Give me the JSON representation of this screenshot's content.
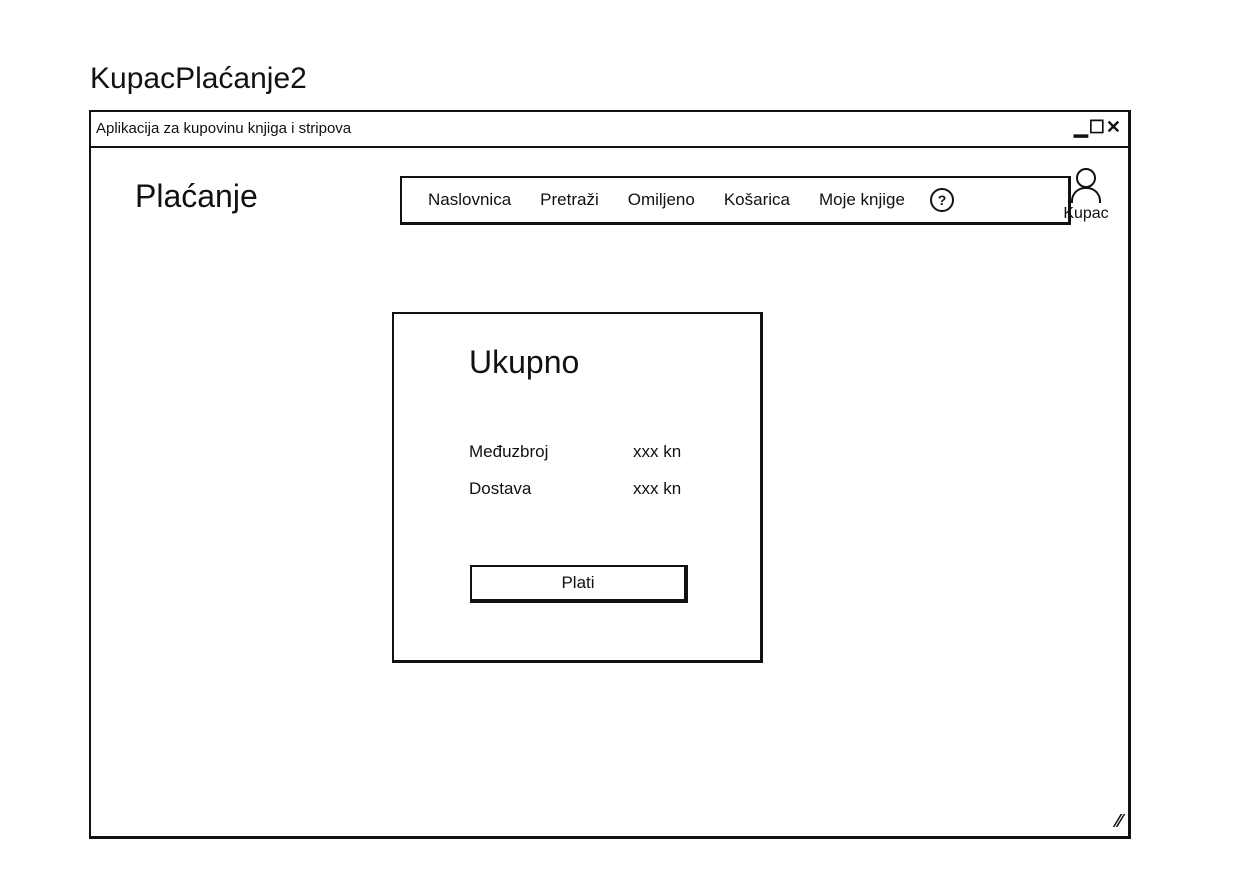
{
  "page_title": "KupacPlaćanje2",
  "window": {
    "title": "Aplikacija za kupovinu knjiga i stripova",
    "controls": "▁☐✕",
    "resize_icon": "⁄⁄"
  },
  "header": {
    "heading": "Plaćanje",
    "nav": [
      {
        "label": "Naslovnica"
      },
      {
        "label": "Pretraži"
      },
      {
        "label": "Omiljeno"
      },
      {
        "label": "Košarica"
      },
      {
        "label": "Moje knjige"
      }
    ],
    "help": "?",
    "user_label": "Kupac"
  },
  "summary": {
    "title": "Ukupno",
    "rows": [
      {
        "label": "Međuzbroj",
        "value": "xxx kn"
      },
      {
        "label": "Dostava",
        "value": "xxx kn"
      }
    ],
    "pay_label": "Plati"
  }
}
